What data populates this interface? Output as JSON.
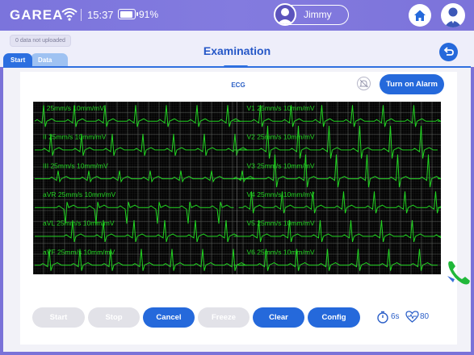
{
  "status_bar": {
    "brand": "GAREA",
    "time": "15:37",
    "battery_percent": "91%",
    "battery_level": 0.91,
    "user_name": "Jimmy",
    "icons": [
      "wifi-icon",
      "battery-icon",
      "user-avatar-icon",
      "home-icon",
      "doctor-avatar-icon"
    ]
  },
  "header": {
    "upload_status": "0 data not uploaded",
    "tabs": [
      {
        "label": "Start",
        "active": true
      },
      {
        "label": "Data",
        "active": false
      }
    ],
    "title": "Examination",
    "back_icon": "back-arrow-icon"
  },
  "ecg": {
    "label": "ECG",
    "alarm_button": "Turn on Alarm",
    "grid_color": "#9aa09a",
    "trace_color": "#22d422",
    "leads": [
      {
        "name": "I",
        "speed": "25mm/s",
        "gain": "10mm/mV"
      },
      {
        "name": "II",
        "speed": "25mm/s",
        "gain": "10mm/mV"
      },
      {
        "name": "III",
        "speed": "25mm/s",
        "gain": "10mm/mV"
      },
      {
        "name": "aVR",
        "speed": "25mm/s",
        "gain": "10mm/mV"
      },
      {
        "name": "aVL",
        "speed": "25mm/s",
        "gain": "10mm/mV"
      },
      {
        "name": "aVF",
        "speed": "25mm/s",
        "gain": "10mm/mV"
      },
      {
        "name": "V1",
        "speed": "25mm/s",
        "gain": "10mm/mV"
      },
      {
        "name": "V2",
        "speed": "25mm/s",
        "gain": "10mm/mV"
      },
      {
        "name": "V3",
        "speed": "25mm/s",
        "gain": "10mm/mV"
      },
      {
        "name": "V4",
        "speed": "25mm/s",
        "gain": "10mm/mV"
      },
      {
        "name": "V5",
        "speed": "25mm/s",
        "gain": "10mm/mV"
      },
      {
        "name": "V6",
        "speed": "25mm/s",
        "gain": "10mm/mV"
      }
    ]
  },
  "controls": {
    "buttons": [
      {
        "label": "Start",
        "enabled": false
      },
      {
        "label": "Stop",
        "enabled": false
      },
      {
        "label": "Cancel",
        "enabled": true
      },
      {
        "label": "Freeze",
        "enabled": false
      },
      {
        "label": "Clear",
        "enabled": true
      },
      {
        "label": "Config",
        "enabled": true
      }
    ],
    "timer": "6s",
    "heart_rate": "80",
    "accent_color": "#2569db"
  }
}
